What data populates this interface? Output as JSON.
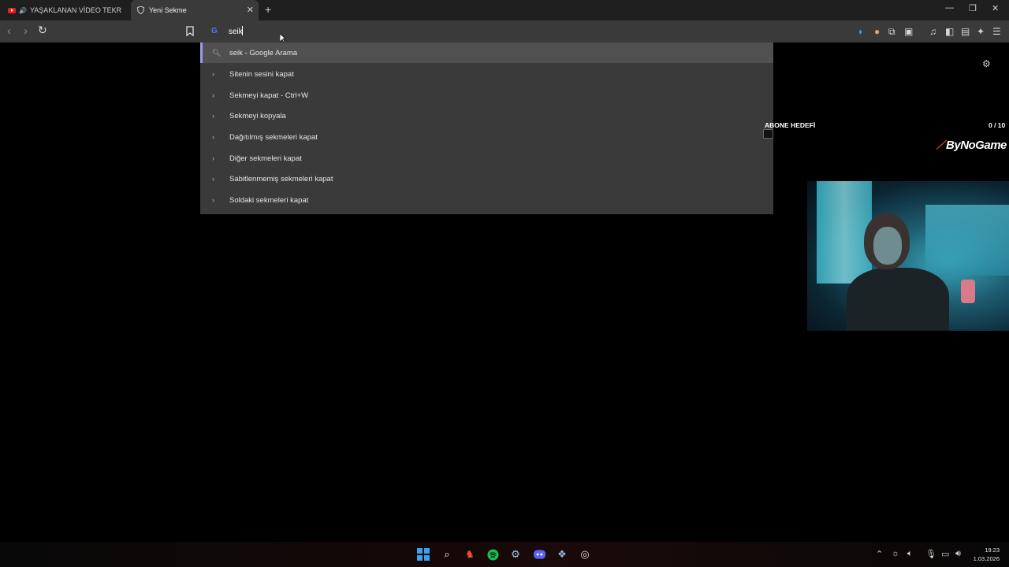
{
  "tabs": [
    {
      "title": "YAŞAKLANAN VİDEO TEKRAR YA",
      "active": false
    },
    {
      "title": "Yeni Sekme",
      "active": true
    }
  ],
  "omnibox": {
    "value": "seik",
    "search_engine_icon": "google-g-icon"
  },
  "suggestions": [
    {
      "label": "seik - Google Arama",
      "icon": "search-icon"
    },
    {
      "label": "Sitenin sesini kapat",
      "icon": "chevron-right-icon"
    },
    {
      "label": "Sekmeyi kapat - Ctrl+W",
      "icon": "chevron-right-icon"
    },
    {
      "label": "Sekmeyi kopyala",
      "icon": "chevron-right-icon"
    },
    {
      "label": "Dağıtılmış sekmeleri kapat",
      "icon": "chevron-right-icon"
    },
    {
      "label": "Diğer sekmeleri kapat",
      "icon": "chevron-right-icon"
    },
    {
      "label": "Sabitlenmemiş sekmeleri kapat",
      "icon": "chevron-right-icon"
    },
    {
      "label": "Soldaki sekmeleri kapat",
      "icon": "chevron-right-icon"
    }
  ],
  "overlay": {
    "goal_label": "ABONE HEDEFİ",
    "goal_count": "0 / 10",
    "brand": "ByNoGame"
  },
  "clock": {
    "time": "19:23",
    "date": "1.03.2026"
  },
  "colors": {
    "accent_selected": "#9a9ee8",
    "youtube_red": "#e62117",
    "windows_blue": "#3aa0f0"
  }
}
